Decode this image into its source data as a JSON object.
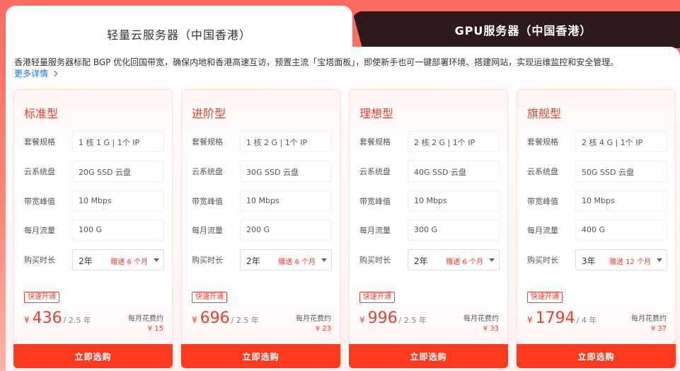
{
  "tabs": {
    "active_label": "轻量云服务器（中国香港）",
    "inactive_label": "GPU服务器（中国香港）"
  },
  "description": "香港轻量服务器标配 BGP 优化回国带宽，确保内地和香港高速互访，预置主流「宝塔面板」，即使新手也可一键部署环境、搭建网站，实现运维监控和安全管理。",
  "more_label": "更多详情",
  "labels": {
    "plan": "套餐规格",
    "disk": "云系统盘",
    "bandwidth": "带宽峰值",
    "traffic": "每月流量",
    "duration": "购买时长",
    "fast": "快速开通",
    "monthly": "每月花费约",
    "buy": "立即选购",
    "currency": "¥"
  },
  "cards": [
    {
      "name": "标准型",
      "plan": "1 核 1 G | 1个 IP",
      "disk": "20G SSD 云盘",
      "bandwidth": "10 Mbps",
      "traffic": "100 G",
      "duration": "2年",
      "gift": "赠送 6 个月",
      "price": "436",
      "period": "/ 2.5 年",
      "monthly": "¥ 15"
    },
    {
      "name": "进阶型",
      "plan": "1 核 2 G | 1个 IP",
      "disk": "30G SSD 云盘",
      "bandwidth": "10 Mbps",
      "traffic": "200 G",
      "duration": "2年",
      "gift": "赠送 6 个月",
      "price": "696",
      "period": "/ 2.5 年",
      "monthly": "¥ 23"
    },
    {
      "name": "理想型",
      "plan": "2 核 2 G | 1个 IP",
      "disk": "40G SSD 云盘",
      "bandwidth": "10 Mbps",
      "traffic": "300 G",
      "duration": "2年",
      "gift": "赠送 6 个月",
      "price": "996",
      "period": "/ 2.5 年",
      "monthly": "¥ 33"
    },
    {
      "name": "旗舰型",
      "plan": "2 核 4 G | 1个 IP",
      "disk": "50G SSD 云盘",
      "bandwidth": "10 Mbps",
      "traffic": "400 G",
      "duration": "3年",
      "gift": "赠送 12 个月",
      "price": "1794",
      "period": "/ 4 年",
      "monthly": "¥ 37"
    }
  ],
  "colors": {
    "accent": "#e8402e",
    "button": "#ff3a1f",
    "dark_tab": "#2d1a1a",
    "link": "#1a73e8"
  }
}
